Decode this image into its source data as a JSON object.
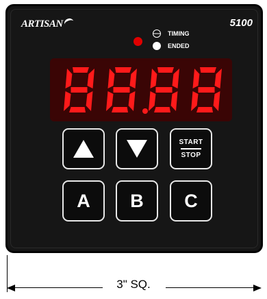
{
  "device": {
    "brand": "ARTISAN",
    "model": "5100"
  },
  "indicators": {
    "timing_label": "TIMING",
    "ended_label": "ENDED"
  },
  "display": {
    "digits": "88.88",
    "segment_color": "#ff1a1a",
    "background": "#3a0505"
  },
  "buttons": {
    "up_icon": "triangle-up-icon",
    "down_icon": "triangle-down-icon",
    "start_label": "START",
    "stop_label": "STOP",
    "a_label": "A",
    "b_label": "B",
    "c_label": "C"
  },
  "dimension": {
    "label": "3\" SQ."
  }
}
